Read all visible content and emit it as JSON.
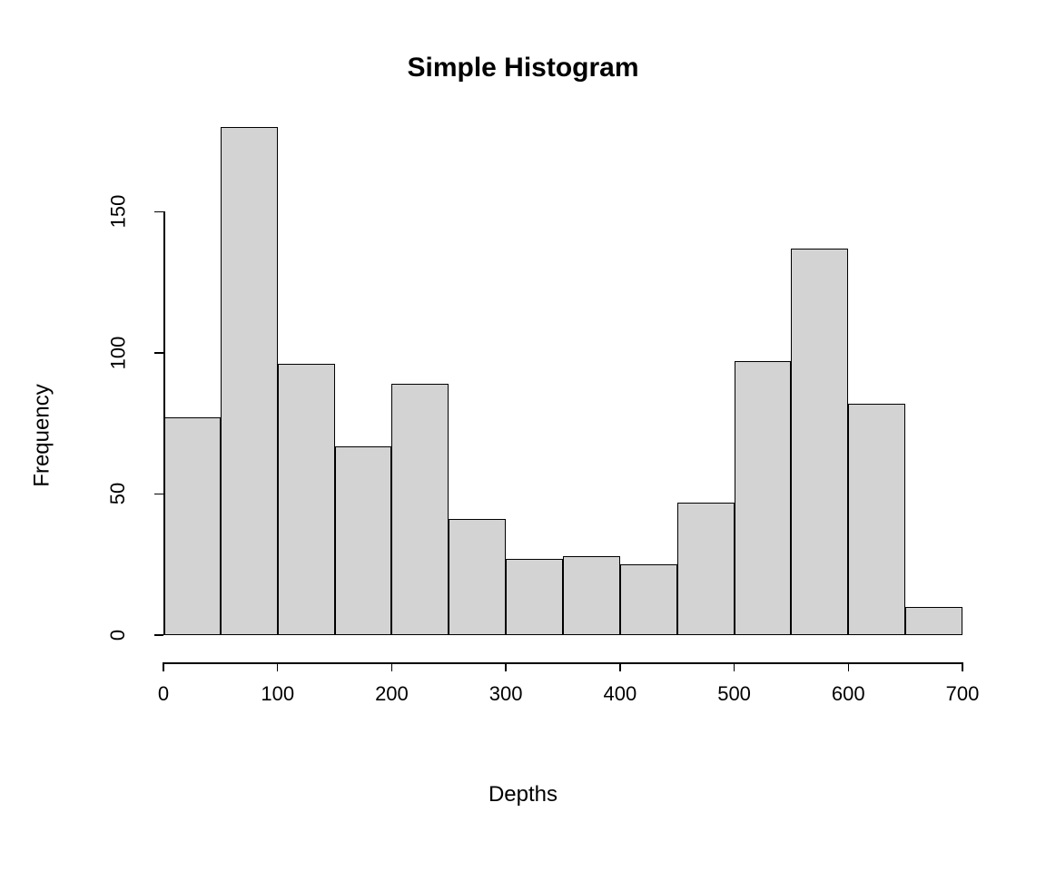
{
  "chart_data": {
    "type": "bar",
    "title": "Simple Histogram",
    "xlabel": "Depths",
    "ylabel": "Frequency",
    "categories": [
      "0-50",
      "50-100",
      "100-150",
      "150-200",
      "200-250",
      "250-300",
      "300-350",
      "350-400",
      "400-450",
      "450-500",
      "500-550",
      "550-600",
      "600-650",
      "650-700"
    ],
    "bin_edges": [
      0,
      50,
      100,
      150,
      200,
      250,
      300,
      350,
      400,
      450,
      500,
      550,
      600,
      650,
      700
    ],
    "values": [
      77,
      180,
      96,
      67,
      89,
      41,
      27,
      28,
      25,
      47,
      97,
      137,
      82,
      10
    ],
    "x_ticks": [
      0,
      100,
      200,
      300,
      400,
      500,
      600,
      700
    ],
    "y_ticks": [
      0,
      50,
      100,
      150
    ],
    "xlim": [
      0,
      700
    ],
    "ylim": [
      0,
      180
    ],
    "bar_fill": "#d3d3d3",
    "bar_stroke": "#000000"
  }
}
